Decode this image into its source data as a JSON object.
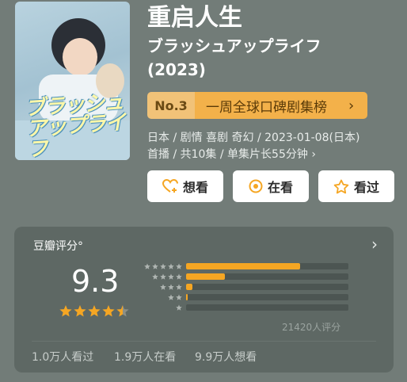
{
  "drama": {
    "title": "重启人生",
    "original_title": "ブラッシュアップライフ",
    "year": "(2023)",
    "poster_text": "ブラッシュアップライフ"
  },
  "ranking": {
    "number": "No.3",
    "name": "一周全球口碑剧集榜",
    "arrow": "›"
  },
  "meta": {
    "line1": "日本 / 剧情 喜剧 奇幻 / 2023-01-08(日本)",
    "line2": "首播 / 共10集 / 单集片长55分钟 ›"
  },
  "actions": {
    "want": "想看",
    "watching": "在看",
    "watched": "看过"
  },
  "rating": {
    "source": "豆瓣评分°",
    "score": "9.3",
    "stars": 4.5,
    "distribution": [
      0.7,
      0.24,
      0.04,
      0.01,
      0.0
    ],
    "count": "21420人评分",
    "watched": "1.0万人看过",
    "watching": "1.9万人在看",
    "wish": "9.9万人想看"
  },
  "colors": {
    "background": "#727c78",
    "accent": "#f5a623",
    "card": "#5e6864"
  }
}
